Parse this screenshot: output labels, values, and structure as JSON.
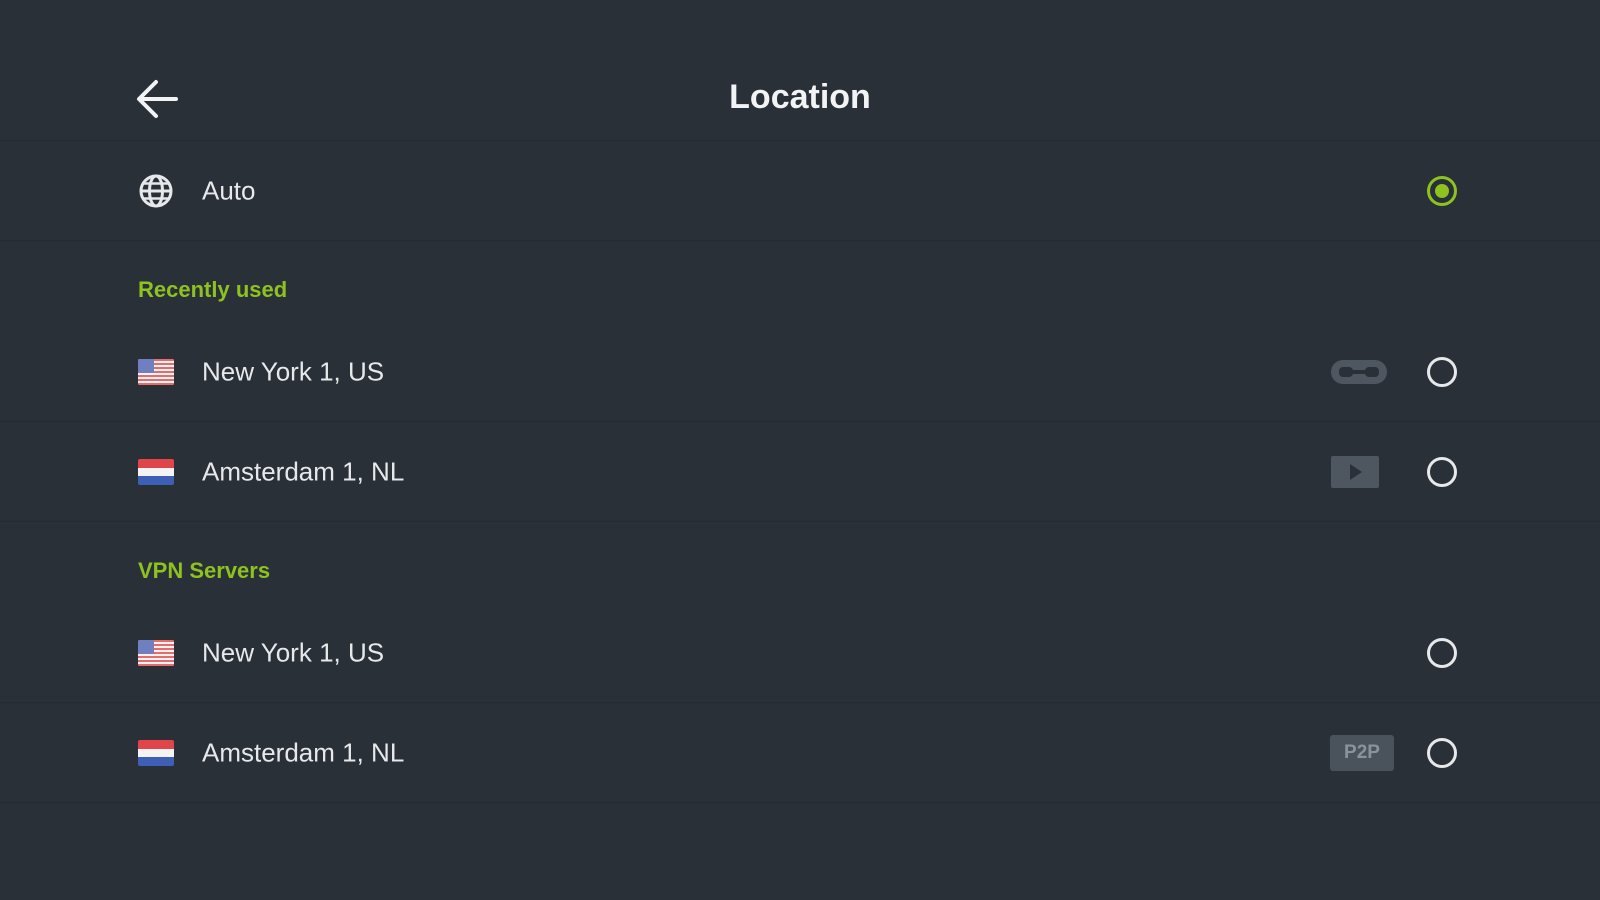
{
  "header": {
    "title": "Location",
    "back_icon": "arrow-left-icon"
  },
  "auto": {
    "label": "Auto",
    "icon": "globe-icon",
    "selected": true
  },
  "sections": [
    {
      "title": "Recently used",
      "items": [
        {
          "label": "New York 1, US",
          "flag": "us-flag-icon",
          "feature": "secure-core-icon",
          "selected": false
        },
        {
          "label": "Amsterdam 1, NL",
          "flag": "nl-flag-icon",
          "feature": "streaming-icon",
          "selected": false
        }
      ]
    },
    {
      "title": "VPN Servers",
      "items": [
        {
          "label": "New York 1, US",
          "flag": "us-flag-icon",
          "feature": "",
          "selected": false
        },
        {
          "label": "Amsterdam 1, NL",
          "flag": "nl-flag-icon",
          "feature": "P2P",
          "selected": false
        }
      ]
    }
  ],
  "colors": {
    "background": "#2a3038",
    "accent": "#8dc21f",
    "text": "#e6e8ea",
    "badge_bg": "#4a525c",
    "badge_text": "#8a929b"
  }
}
